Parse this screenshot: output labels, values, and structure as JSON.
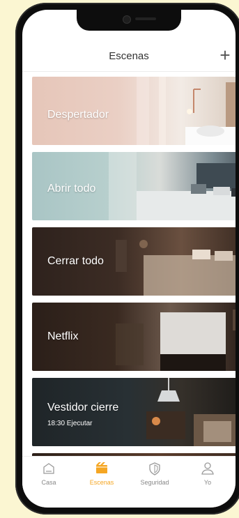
{
  "header": {
    "title": "Escenas",
    "add_label": "+"
  },
  "scenes": [
    {
      "label": "Despertador"
    },
    {
      "label": "Abrir todo"
    },
    {
      "label": "Cerrar todo"
    },
    {
      "label": "Netflix"
    },
    {
      "label": "Vestidor cierre",
      "subtitle": "18:30 Ejecutar"
    }
  ],
  "tabbar": {
    "items": [
      {
        "label": "Casa",
        "icon": "house-icon"
      },
      {
        "label": "Escenas",
        "icon": "scenes-icon"
      },
      {
        "label": "Seguridad",
        "icon": "shield-icon"
      },
      {
        "label": "Yo",
        "icon": "person-icon"
      }
    ],
    "active": "Escenas",
    "active_color": "#f5a623"
  }
}
